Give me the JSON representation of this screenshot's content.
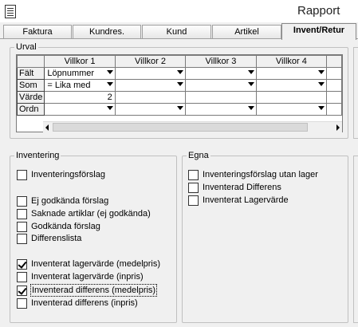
{
  "window": {
    "title": "Rapport",
    "icon": "document-icon"
  },
  "tabs": [
    {
      "label": "Faktura",
      "active": false
    },
    {
      "label": "Kundres.",
      "active": false
    },
    {
      "label": "Kund",
      "active": false
    },
    {
      "label": "Artikel",
      "active": false
    },
    {
      "label": "Invent/Retur",
      "active": true
    }
  ],
  "urval": {
    "label": "Urval",
    "columns": [
      "Villkor 1",
      "Villkor 2",
      "Villkor 3",
      "Villkor 4"
    ],
    "rows": [
      {
        "header": "Fält",
        "cells": [
          "Löpnummer",
          "",
          "",
          ""
        ],
        "dropdown": true
      },
      {
        "header": "Som",
        "cells": [
          "=   Lika med",
          "",
          "",
          ""
        ],
        "dropdown": true
      },
      {
        "header": "Värde",
        "cells": [
          "2",
          "",
          "",
          ""
        ],
        "dropdown": false
      },
      {
        "header": "Ordn",
        "cells": [
          "",
          "",
          "",
          ""
        ],
        "dropdown": true
      }
    ]
  },
  "inventering": {
    "label": "Inventering",
    "items": [
      {
        "label": "Inventeringsförslag",
        "checked": false
      },
      {
        "label": "Ej godkända förslag",
        "checked": false
      },
      {
        "label": "Saknade artiklar (ej godkända)",
        "checked": false
      },
      {
        "label": "Godkända förslag",
        "checked": false
      },
      {
        "label": "Differenslista",
        "checked": false
      },
      {
        "label": "Inventerat lagervärde (medelpris)",
        "checked": true
      },
      {
        "label": "Inventerat lagervärde (inpris)",
        "checked": false
      },
      {
        "label": "Inventerad differens (medelpris)",
        "checked": true
      },
      {
        "label": "Inventerad differens (inpris)",
        "checked": false
      }
    ]
  },
  "egna": {
    "label": "Egna",
    "items": [
      {
        "label": "Inventeringsförslag utan lager",
        "checked": false
      },
      {
        "label": "Inventerad Differens",
        "checked": false
      },
      {
        "label": "Inventerat Lagervärde",
        "checked": false
      }
    ]
  }
}
